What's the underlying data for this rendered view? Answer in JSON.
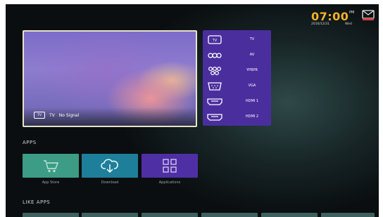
{
  "status": {
    "time": "07:00",
    "ampm": "PM",
    "date": "2016/12/31",
    "weekday": "Wed"
  },
  "preview": {
    "source_badge": "TV",
    "channel": "TV",
    "signal": "No Signal"
  },
  "sources": [
    {
      "label": "TV",
      "icon": "tv-icon",
      "badge": "TV"
    },
    {
      "label": "AV",
      "icon": "av-icon"
    },
    {
      "label": "YPBPR",
      "icon": "ypbpr-icon"
    },
    {
      "label": "VGA",
      "icon": "vga-icon"
    },
    {
      "label": "HDMI 1",
      "icon": "hdmi-icon"
    },
    {
      "label": "HDMI 2",
      "icon": "hdmi-icon"
    }
  ],
  "apps": {
    "heading": "APPS",
    "items": [
      {
        "label": "App Store",
        "icon": "store-icon",
        "color": "#3c9c86"
      },
      {
        "label": "Download",
        "icon": "cloud-download-icon",
        "color": "#1e7f9a"
      },
      {
        "label": "Applications",
        "icon": "grid-icon",
        "color": "#4f2fa4"
      }
    ]
  },
  "like_apps": {
    "heading": "LIKE APPS"
  }
}
